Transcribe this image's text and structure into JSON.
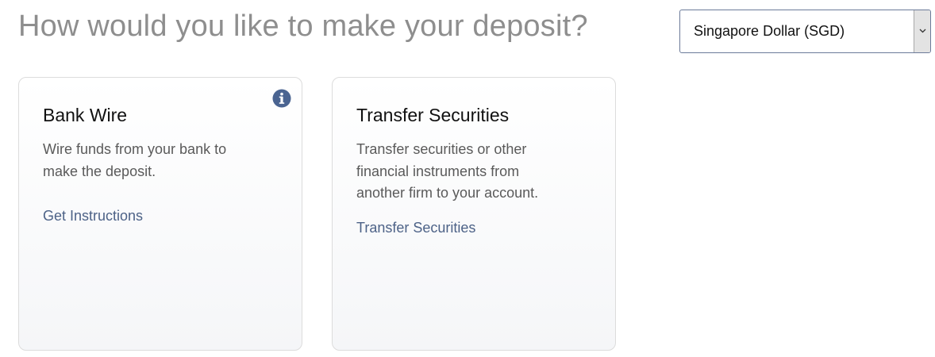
{
  "heading": "How would you like to make your deposit?",
  "currency_select": {
    "selected": "Singapore Dollar (SGD)",
    "arrow_icon": "chevron-down-icon"
  },
  "cards": {
    "bank_wire": {
      "title": "Bank Wire",
      "description": "Wire funds from your bank to make the deposit.",
      "link": "Get Instructions",
      "info_icon": "info-icon"
    },
    "transfer_securities": {
      "title": "Transfer Securities",
      "description": "Transfer securities or other financial instruments from another firm to your account.",
      "link": "Transfer Securities"
    }
  },
  "colors": {
    "heading": "#8e8e8e",
    "link": "#4d6287",
    "info_icon": "#4a6491",
    "card_border": "#dcdcdc"
  }
}
